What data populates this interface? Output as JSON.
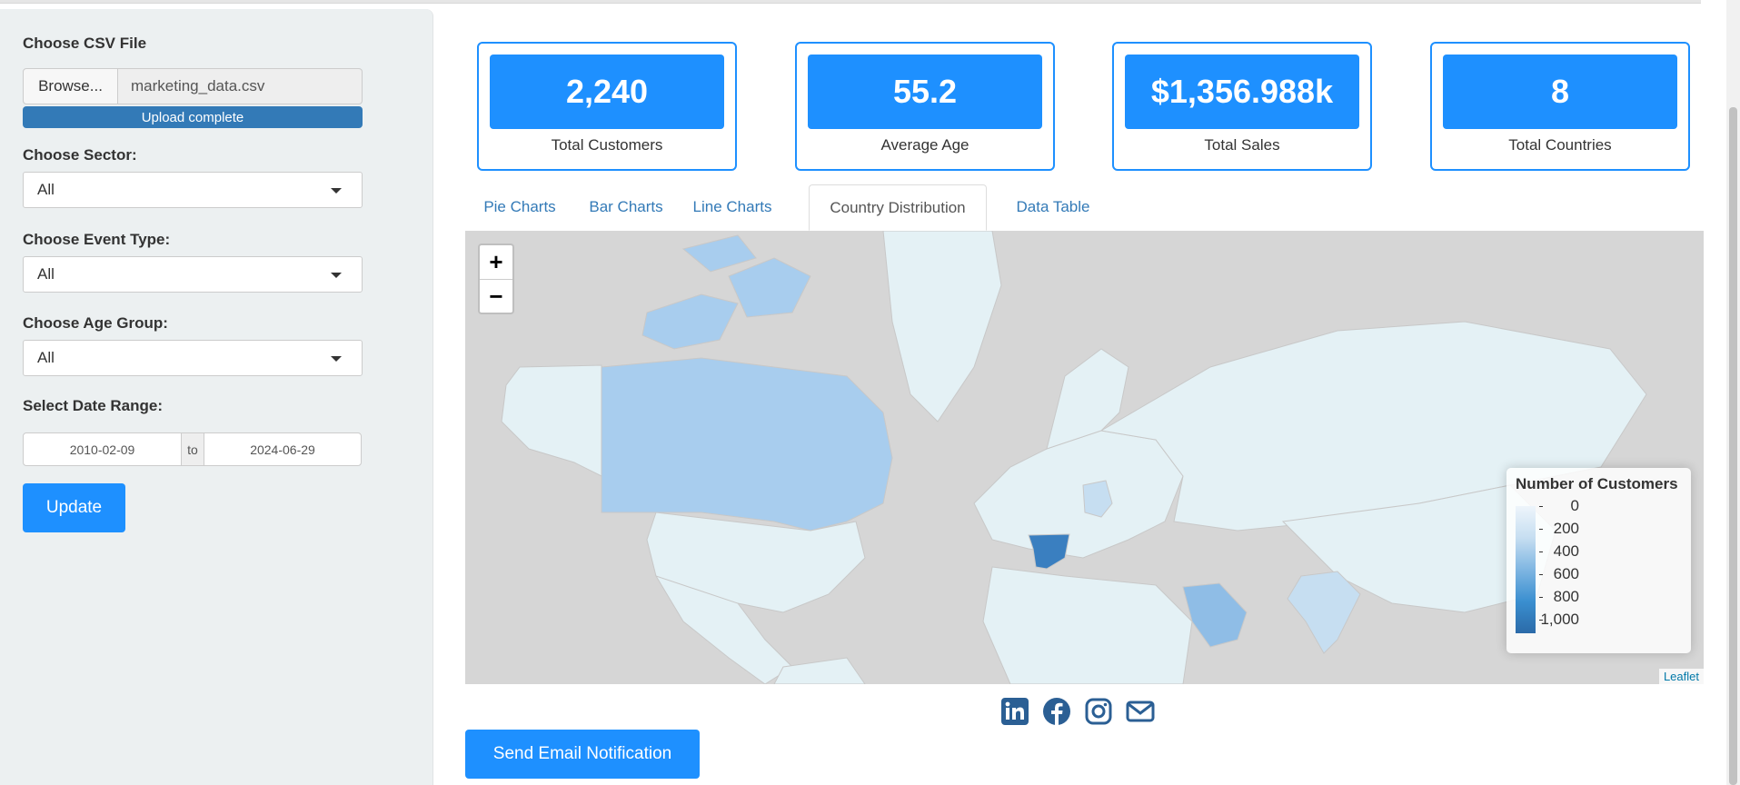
{
  "sidebar": {
    "csv_label": "Choose CSV File",
    "browse_label": "Browse...",
    "file_name": "marketing_data.csv",
    "upload_status": "Upload complete",
    "upload_progress": 1.0,
    "sector_label": "Choose Sector:",
    "sector_value": "All",
    "event_label": "Choose Event Type:",
    "event_value": "All",
    "age_label": "Choose Age Group:",
    "age_value": "All",
    "date_label": "Select Date Range:",
    "date_start": "2010-02-09",
    "date_sep": "to",
    "date_end": "2024-06-29",
    "update_label": "Update"
  },
  "value_boxes": [
    {
      "value": "2,240",
      "caption": "Total Customers"
    },
    {
      "value": "55.2",
      "caption": "Average Age"
    },
    {
      "value": "$1,356.988k",
      "caption": "Total Sales"
    },
    {
      "value": "8",
      "caption": "Total Countries"
    }
  ],
  "tabs": [
    {
      "label": "Pie Charts",
      "active": false
    },
    {
      "label": "Bar Charts",
      "active": false
    },
    {
      "label": "Line Charts",
      "active": false
    },
    {
      "label": "Country Distribution",
      "active": true
    },
    {
      "label": "Data Table",
      "active": false
    }
  ],
  "map": {
    "zoom_in": "+",
    "zoom_out": "−",
    "legend_title": "Number of Customers",
    "legend_values": [
      "0",
      "200",
      "400",
      "600",
      "800",
      "1,000"
    ],
    "attribution": "Leaflet",
    "colors": {
      "low": "#eef5fb",
      "high": "#2b6aa8",
      "land": "#dff0f5",
      "background": "#d6d6d6"
    }
  },
  "social_icons": [
    "linkedin-icon",
    "facebook-icon",
    "instagram-icon",
    "email-icon"
  ],
  "email_button_label": "Send Email Notification",
  "accent_color": "#1e90ff"
}
